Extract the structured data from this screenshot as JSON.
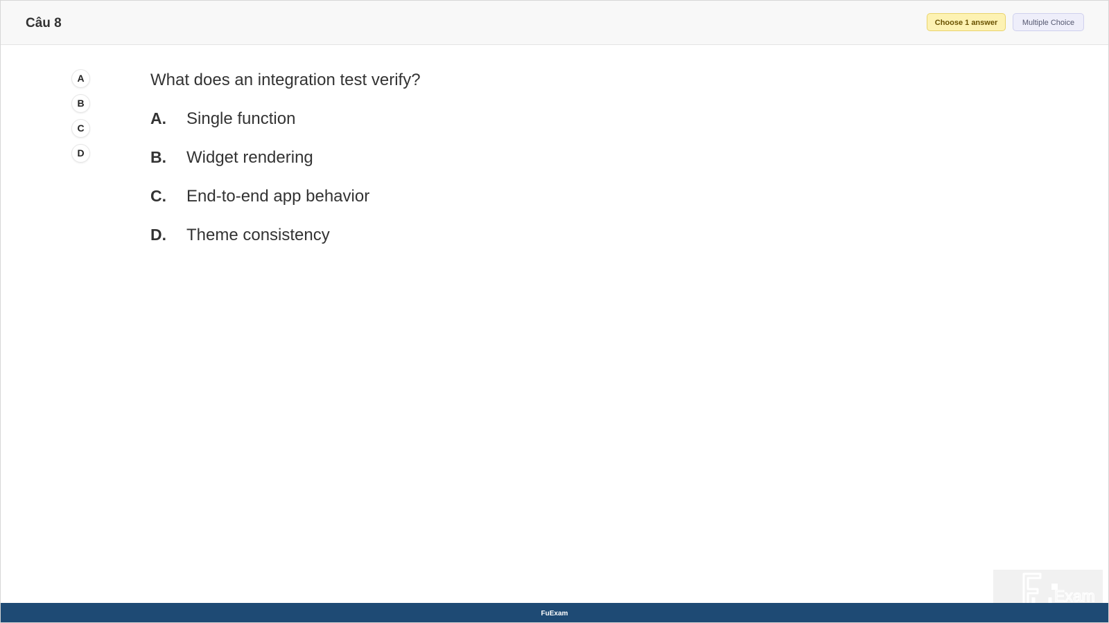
{
  "header": {
    "question_number": "Câu 8",
    "choose_badge": "Choose 1 answer",
    "type_badge": "Multiple Choice"
  },
  "answer_nav": {
    "items": [
      "A",
      "B",
      "C",
      "D"
    ]
  },
  "question": {
    "text": "What does an integration test verify?",
    "options": [
      {
        "letter": "A.",
        "text": "Single function"
      },
      {
        "letter": "B.",
        "text": "Widget rendering"
      },
      {
        "letter": "C.",
        "text": "End-to-end app behavior"
      },
      {
        "letter": "D.",
        "text": "Theme consistency"
      }
    ]
  },
  "footer": {
    "brand": "FuExam"
  },
  "watermark": {
    "logo_text": "FU Exam"
  },
  "colors": {
    "footer_bg": "#1e4a74",
    "choose_badge_bg": "#fdf2b3",
    "type_badge_bg": "#eeeefa"
  }
}
